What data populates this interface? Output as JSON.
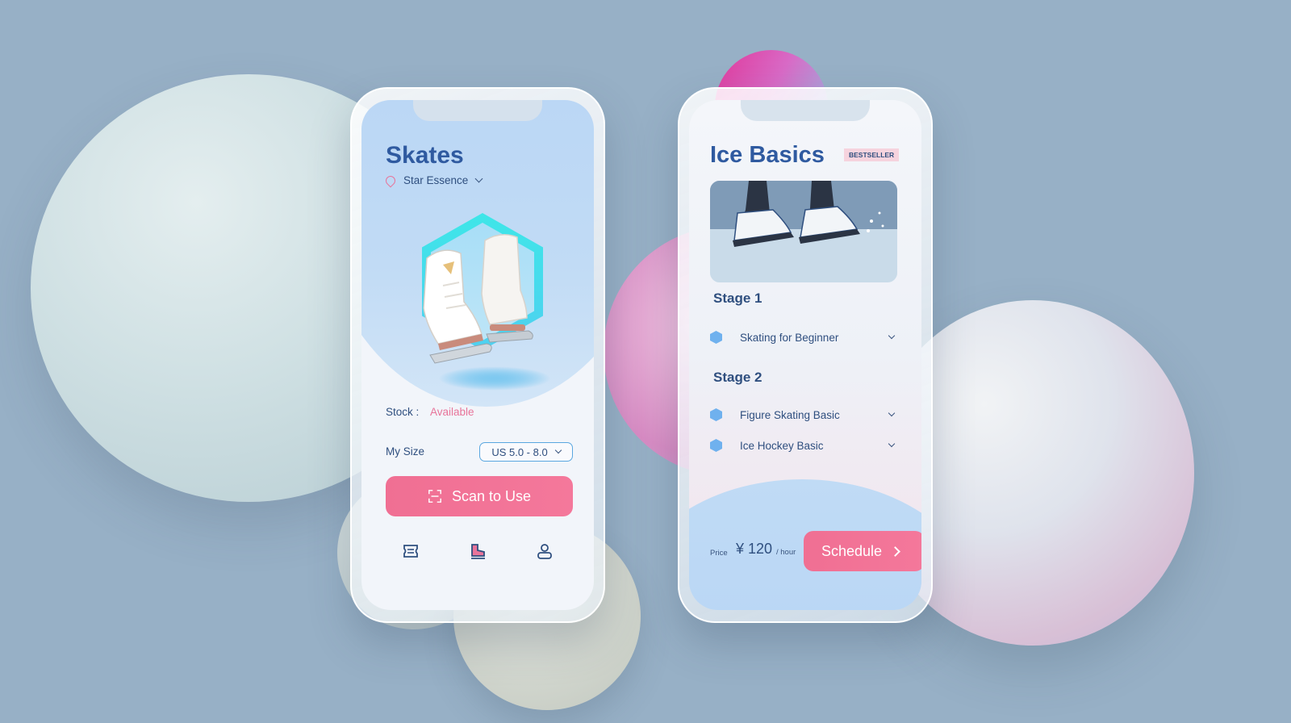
{
  "left_screen": {
    "title": "Skates",
    "location": "Star Essence",
    "stock_label": "Stock :",
    "stock_value": "Available",
    "size_label": "My Size",
    "size_value": "US 5.0 - 8.0",
    "scan_button": "Scan to Use",
    "tabs": [
      {
        "icon": "ticket-icon"
      },
      {
        "icon": "skate-icon"
      },
      {
        "icon": "profile-icon"
      }
    ]
  },
  "right_screen": {
    "title": "Ice Basics",
    "badge": "BESTSELLER",
    "stages": [
      {
        "label": "Stage 1",
        "courses": [
          "Skating for Beginner"
        ]
      },
      {
        "label": "Stage 2",
        "courses": [
          "Figure Skating Basic",
          "Ice Hockey Basic"
        ]
      }
    ],
    "price_label": "Price",
    "price": "¥ 120",
    "price_unit": "/ hour",
    "schedule_button": "Schedule"
  },
  "colors": {
    "background": "#97b0c6",
    "title_blue": "#2f5aa0",
    "text_navy": "#2f4f7f",
    "accent_pink": "#f06f93",
    "hex_cyan": "#3ee6e8",
    "dot_blue": "#6fb1ee"
  }
}
